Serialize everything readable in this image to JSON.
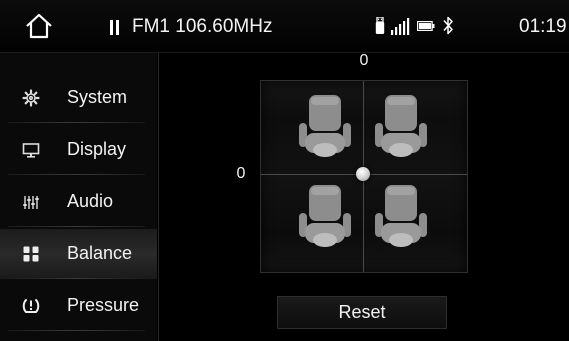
{
  "status_bar": {
    "home_icon": "home-icon",
    "media_state_icon": "pause-icon",
    "radio_text": "FM1 106.60MHz",
    "indicators": [
      "usb-icon",
      "signal-bars-icon",
      "battery-icon",
      "bluetooth-icon"
    ],
    "time": "01:19"
  },
  "sidebar": {
    "items": [
      {
        "label": "System",
        "icon": "gear-icon",
        "active": false
      },
      {
        "label": "Display",
        "icon": "monitor-icon",
        "active": false
      },
      {
        "label": "Audio",
        "icon": "equalizer-icon",
        "active": false
      },
      {
        "label": "Balance",
        "icon": "balance-grid-icon",
        "active": true
      },
      {
        "label": "Pressure",
        "icon": "tire-pressure-icon",
        "active": false
      }
    ]
  },
  "balance": {
    "front_rear_value": "0",
    "left_right_value": "0",
    "seats": [
      "front-left",
      "front-right",
      "rear-left",
      "rear-right"
    ],
    "reset_label": "Reset"
  }
}
